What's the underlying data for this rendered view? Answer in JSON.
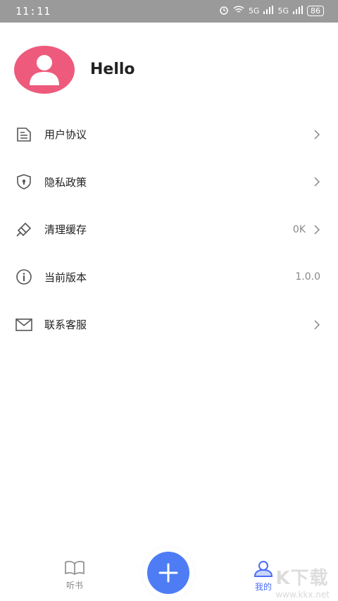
{
  "status_bar": {
    "time": "11:11",
    "signal1": "5G",
    "signal2": "5G",
    "battery": "86"
  },
  "profile": {
    "name": "Hello"
  },
  "menu": {
    "items": [
      {
        "label": "用户协议",
        "icon": "document-icon",
        "value": "",
        "chevron": true
      },
      {
        "label": "隐私政策",
        "icon": "shield-icon",
        "value": "",
        "chevron": true
      },
      {
        "label": "清理缓存",
        "icon": "broom-icon",
        "value": "0K",
        "chevron": true
      },
      {
        "label": "当前版本",
        "icon": "info-icon",
        "value": "1.0.0",
        "chevron": false
      },
      {
        "label": "联系客服",
        "icon": "mail-icon",
        "value": "",
        "chevron": true
      }
    ]
  },
  "tabbar": {
    "listen_label": "听书",
    "add_icon": "plus-icon",
    "mine_label": "我的"
  },
  "watermark": {
    "brand": "K下载",
    "url": "www.kkx.net"
  },
  "colors": {
    "status_bar": "#9a9a9a",
    "avatar": "#ee5a7c",
    "accent": "#4d7cf5",
    "tab_active": "#4a6cf7"
  }
}
